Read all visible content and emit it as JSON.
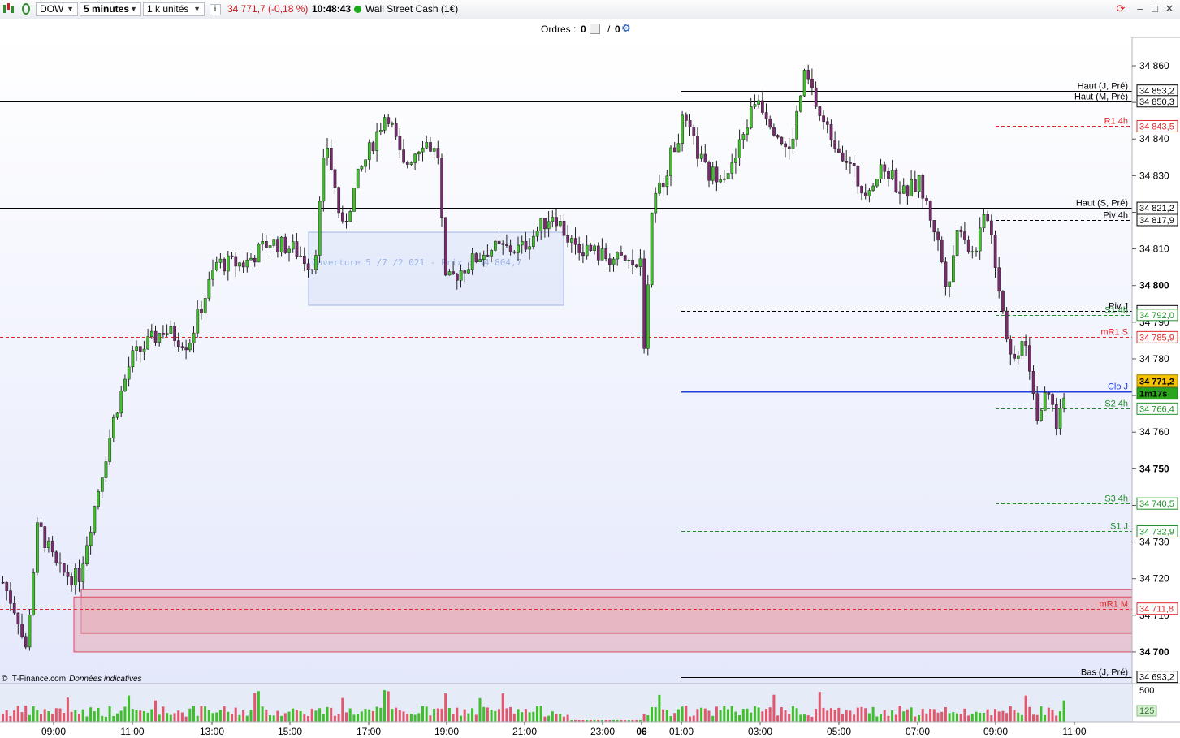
{
  "toolbar": {
    "symbol": "DOW",
    "timeframe": "5 minutes",
    "units": "1 k unités",
    "price_change": "34 771,7 (-0,18 %)",
    "time": "10:48:43",
    "instrument": "Wall Street Cash (1€)",
    "colors": {
      "down_text": "#d3141c",
      "status_dot": "#19a619"
    }
  },
  "orders_bar": {
    "label": "Ordres :",
    "left_count": "0",
    "separator": "/",
    "right_count": "0"
  },
  "footer": {
    "credit": "© IT-Finance.com",
    "note": "Données indicatives"
  },
  "annotation": {
    "text": "Ouverture 5 /7 /2 021   - Prix : 34 804,7"
  },
  "chart_data": {
    "type": "candlestick",
    "ylim": [
      34690,
      34866
    ],
    "y_ticks": [
      "34 700",
      "34 710",
      "34 720",
      "34 730",
      "34 740",
      "34 750",
      "34 760",
      "34 770",
      "34 780",
      "34 790",
      "34 800",
      "34 810",
      "34 820",
      "34 830",
      "34 840",
      "34 850",
      "34 860"
    ],
    "x_ticks": [
      "09:00",
      "11:00",
      "13:00",
      "15:00",
      "17:00",
      "19:00",
      "21:00",
      "23:00",
      "06",
      "01:00",
      "03:00",
      "05:00",
      "07:00",
      "09:00",
      "11:00"
    ],
    "last_price": "34 771,2",
    "countdown": "1m17s",
    "volume_ticks": [
      "500",
      "125"
    ],
    "levels": [
      {
        "label": "Haut (J, Pré)",
        "value": 34853.2,
        "display": "34 853,2",
        "color": "#000000",
        "style": "solid",
        "start": "03:00 prev"
      },
      {
        "label": "Haut (M, Pré)",
        "value": 34850.3,
        "display": "34 850,3",
        "color": "#000000",
        "style": "solid",
        "start": "full"
      },
      {
        "label": "R1 4h",
        "value": 34843.5,
        "display": "34 843,5",
        "color": "#e0282c",
        "style": "dashed",
        "start": "09:00"
      },
      {
        "label": "Haut (S, Pré)",
        "value": 34821.2,
        "display": "34 821,2",
        "color": "#000000",
        "style": "solid",
        "start": "full"
      },
      {
        "label": "Piv 4h",
        "value": 34817.9,
        "display": "34 817,9",
        "color": "#000000",
        "style": "dashed",
        "start": "09:00"
      },
      {
        "label": "Piv J",
        "value": 34793.0,
        "display": "34 793,0",
        "color": "#000000",
        "style": "dashed",
        "start": "01:00"
      },
      {
        "label": "S1 4h",
        "value": 34792.0,
        "display": "34 792,0",
        "color": "#1f8f2a",
        "style": "dashed",
        "start": "09:00"
      },
      {
        "label": "mR1 S",
        "value": 34785.9,
        "display": "34 785,9",
        "color": "#e0282c",
        "style": "dashed",
        "start": "full"
      },
      {
        "label": "Clo J",
        "value": 34771.2,
        "display": "34 771,2",
        "color": "#1f3fe0",
        "style": "solid",
        "start": "01:00"
      },
      {
        "label": "S2 4h",
        "value": 34766.4,
        "display": "34 766,4",
        "color": "#1f8f2a",
        "style": "dashed",
        "start": "09:00"
      },
      {
        "label": "S3 4h",
        "value": 34740.5,
        "display": "34 740,5",
        "color": "#1f8f2a",
        "style": "dashed",
        "start": "09:00"
      },
      {
        "label": "S1 J",
        "value": 34732.9,
        "display": "34 732,9",
        "color": "#1f8f2a",
        "style": "dashed",
        "start": "01:00"
      },
      {
        "label": "mR1 M",
        "value": 34711.8,
        "display": "34 711,8",
        "color": "#e0282c",
        "style": "dashed",
        "start": "full"
      },
      {
        "label": "Bas (J, Pré)",
        "value": 34693.2,
        "display": "34 693,2",
        "color": "#000000",
        "style": "solid",
        "start": "01:00"
      }
    ],
    "zones": [
      {
        "y1": 34705,
        "y2": 34717,
        "color": "#e8a9b6"
      },
      {
        "y1": 34700,
        "y2": 34715,
        "color": "#e8a9b6"
      }
    ],
    "colors": {
      "up": "#3fbf2a",
      "down": "#7a2a6e",
      "price_tag": "#f5c400",
      "countdown_tag": "#2aa51c"
    }
  }
}
